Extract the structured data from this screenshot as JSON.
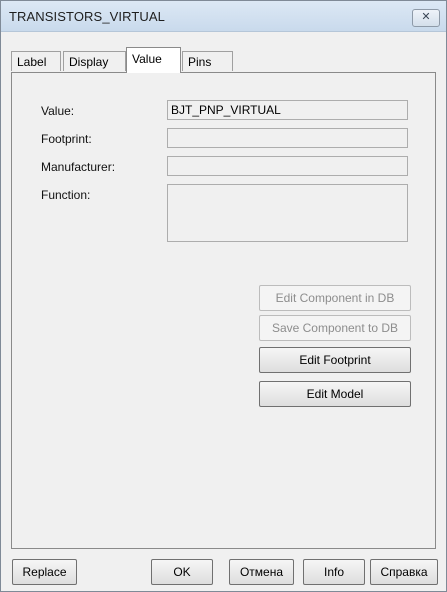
{
  "window": {
    "title": "TRANSISTORS_VIRTUAL",
    "close_glyph": "✕"
  },
  "tabs": [
    {
      "label": "Label"
    },
    {
      "label": "Display"
    },
    {
      "label": "Value"
    },
    {
      "label": "Pins"
    }
  ],
  "active_tab": "Value",
  "fields": {
    "value": {
      "label": "Value:",
      "value": "BJT_PNP_VIRTUAL"
    },
    "footprint": {
      "label": "Footprint:",
      "value": ""
    },
    "manufacturer": {
      "label": "Manufacturer:",
      "value": ""
    },
    "function": {
      "label": "Function:",
      "value": ""
    }
  },
  "actions": {
    "edit_component_db": "Edit Component in DB",
    "save_component_db": "Save Component to DB",
    "edit_footprint": "Edit Footprint",
    "edit_model": "Edit Model"
  },
  "footer": {
    "replace": "Replace",
    "ok": "OK",
    "cancel": "Отмена",
    "info": "Info",
    "help": "Справка"
  }
}
